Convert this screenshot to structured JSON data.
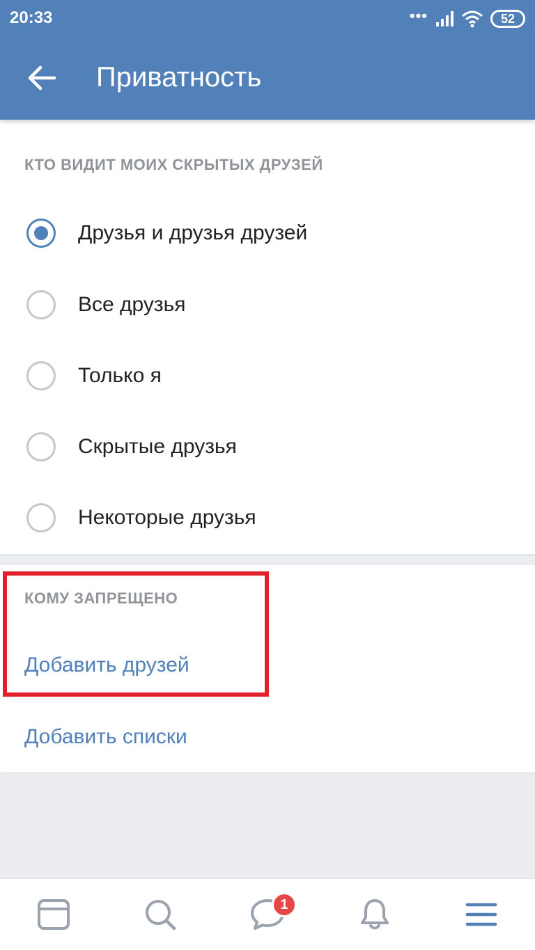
{
  "status_bar": {
    "time": "20:33",
    "battery": "52"
  },
  "toolbar": {
    "title": "Приватность"
  },
  "hidden_friends": {
    "header": "КТО ВИДИТ МОИХ СКРЫТЫХ ДРУЗЕЙ",
    "options": [
      {
        "label": "Друзья и друзья друзей",
        "selected": true
      },
      {
        "label": "Все друзья",
        "selected": false
      },
      {
        "label": "Только я",
        "selected": false
      },
      {
        "label": "Скрытые друзья",
        "selected": false
      },
      {
        "label": "Некоторые друзья",
        "selected": false
      }
    ]
  },
  "forbidden": {
    "header": "КОМУ ЗАПРЕЩЕНО",
    "add_friends": "Добавить друзей",
    "add_lists": "Добавить списки"
  },
  "bottom_nav": {
    "items": [
      {
        "icon": "news-icon"
      },
      {
        "icon": "search-icon"
      },
      {
        "icon": "messages-icon",
        "badge": "1"
      },
      {
        "icon": "bell-icon"
      },
      {
        "icon": "menu-icon"
      }
    ]
  },
  "colors": {
    "accent": "#5181b8",
    "highlight": "#e0212b",
    "badge": "#e64646"
  }
}
